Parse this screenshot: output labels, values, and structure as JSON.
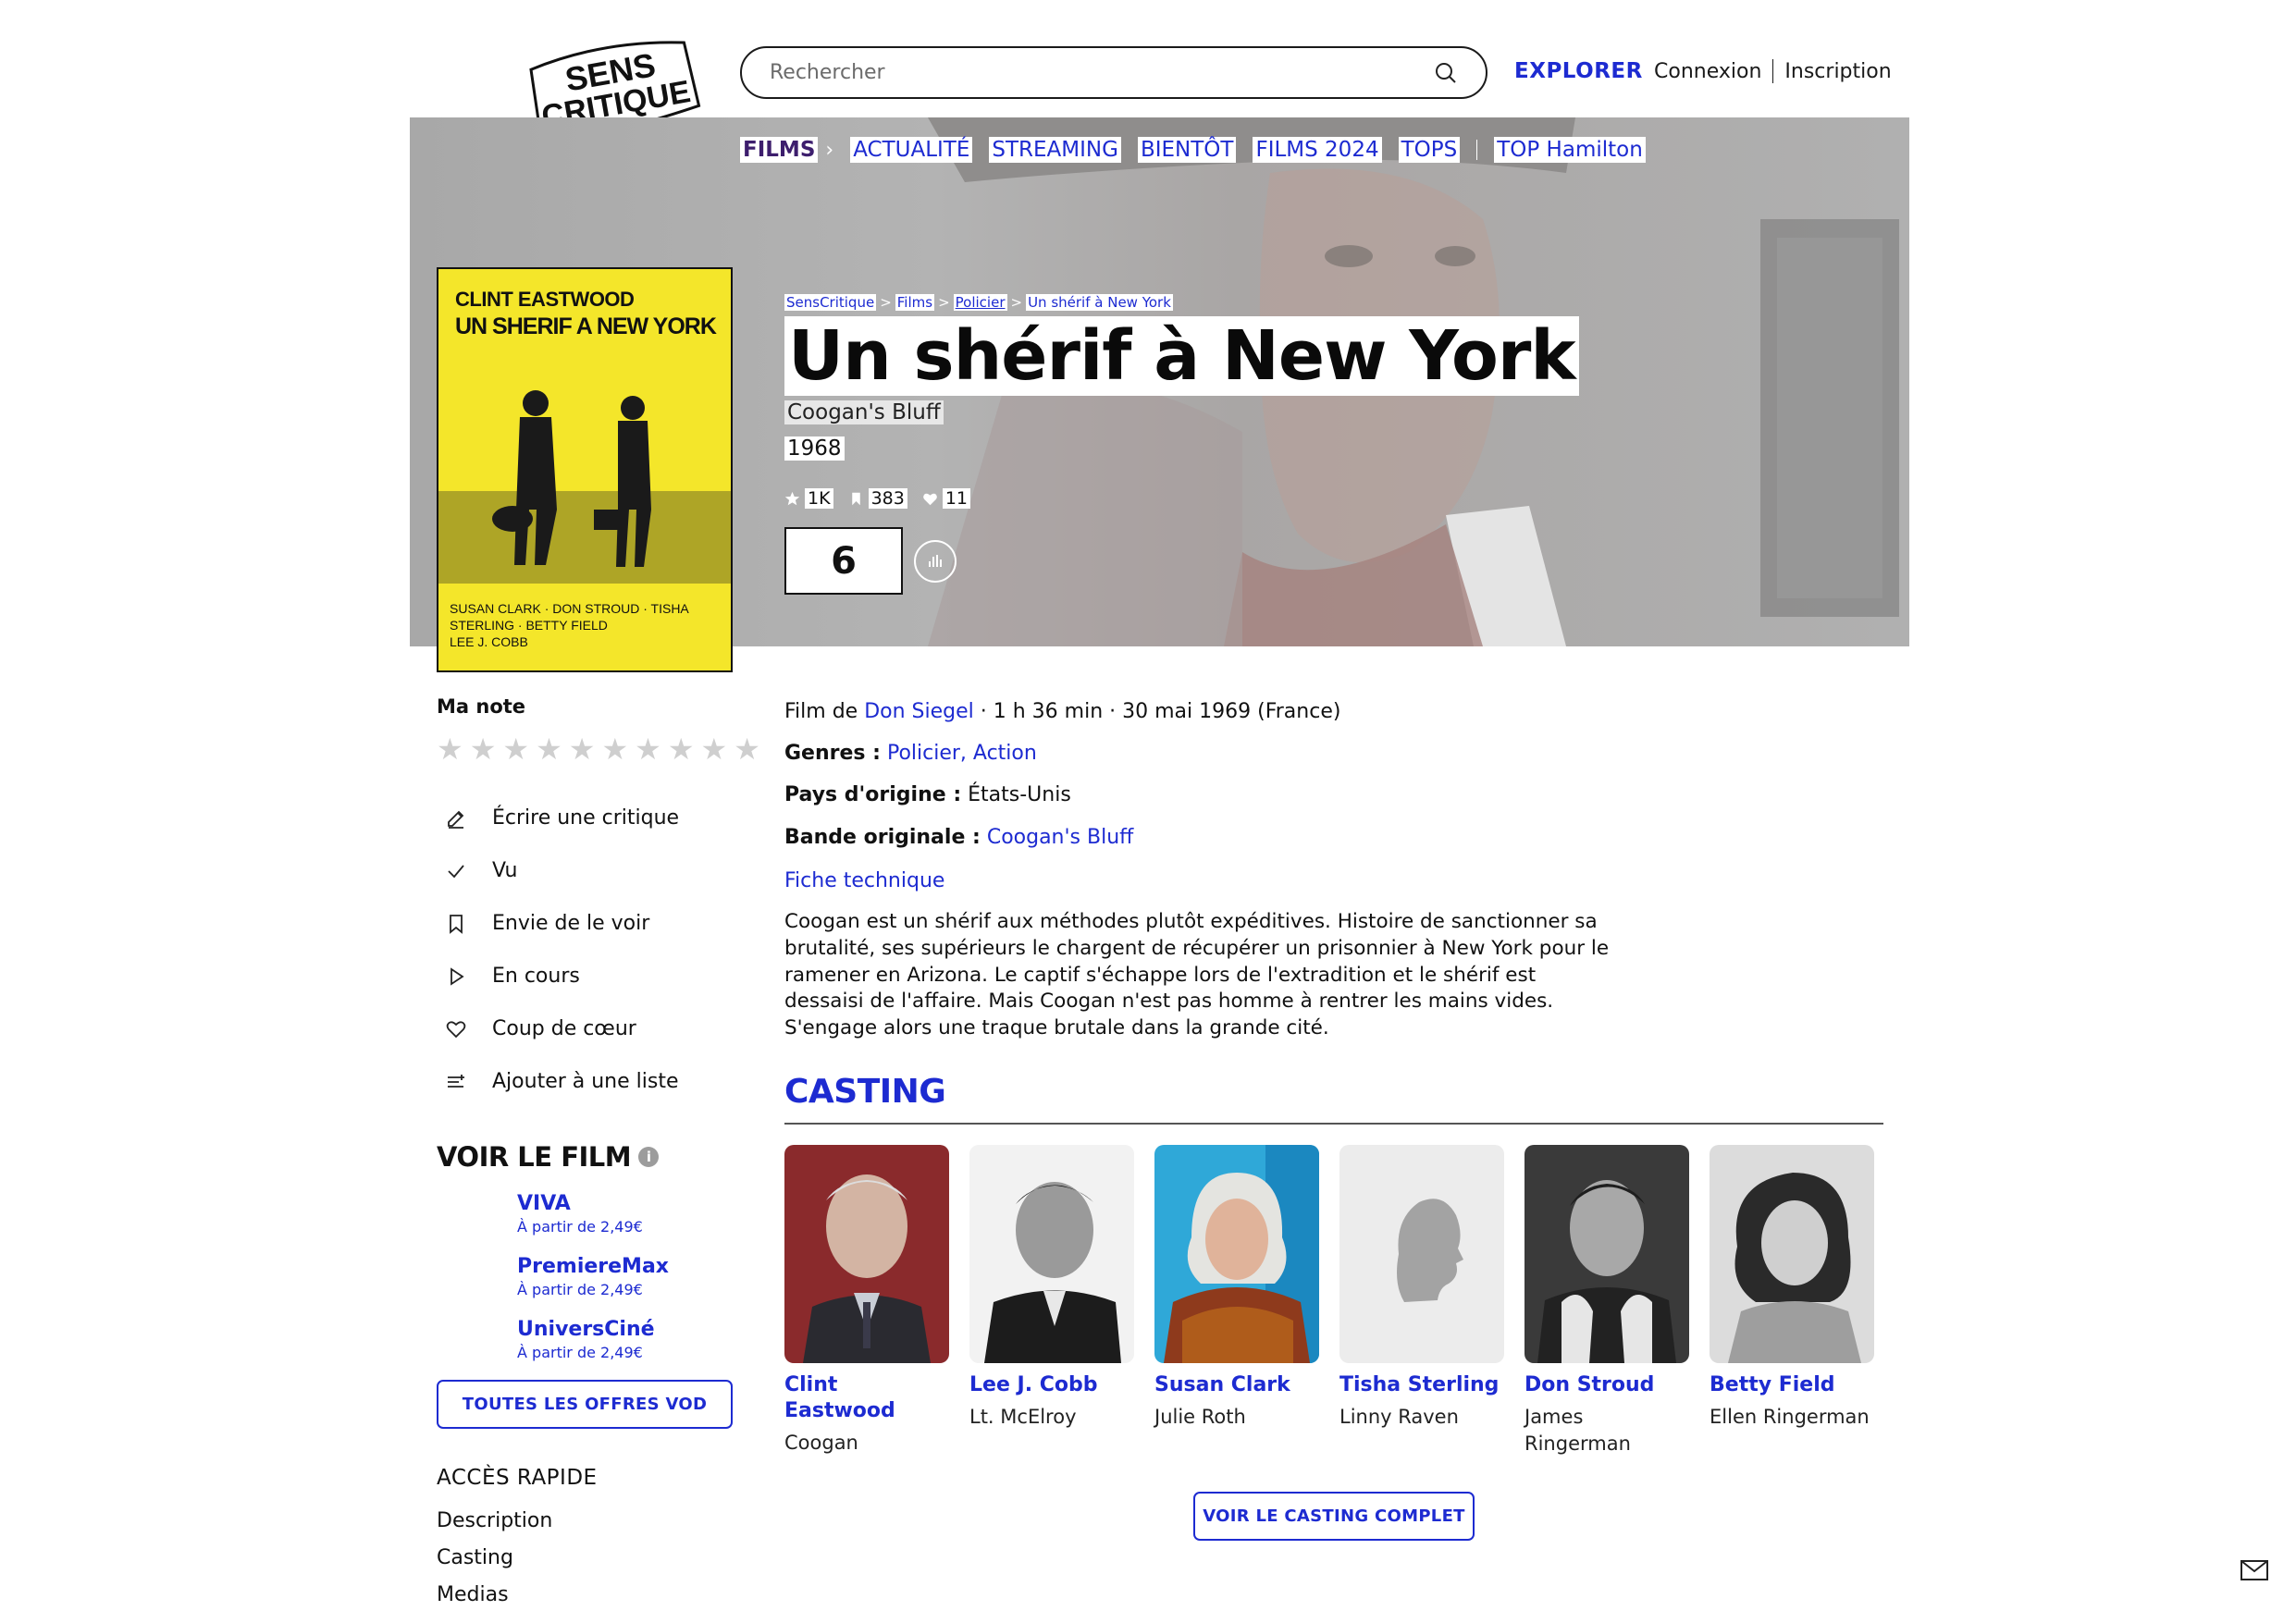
{
  "header": {
    "logo_lines": [
      "SENS",
      "CRITIQUE"
    ],
    "search_placeholder": "Rechercher",
    "explorer": "EXPLORER",
    "login": "Connexion",
    "signup": "Inscription"
  },
  "nav": {
    "items": [
      "FILMS",
      "ACTUALITÉ",
      "STREAMING",
      "BIENTÔT",
      "FILMS 2024",
      "TOPS"
    ],
    "extra": "TOP Hamilton"
  },
  "breadcrumb": [
    "SensCritique",
    "Films",
    "Policier",
    "Un shérif à New York"
  ],
  "film": {
    "title": "Un shérif à New York",
    "original_title": "Coogan's Bluff",
    "year": "1968",
    "stats": {
      "ratings": "1K",
      "wishlist": "383",
      "favorites": "11"
    },
    "score": "6",
    "poster": {
      "actor": "CLINT EASTWOOD",
      "title": "UN SHERIF A NEW YORK",
      "credits_1": "SUSAN CLARK · DON STROUD · TISHA STERLING · BETTY FIELD",
      "credits_2": "LEE J. COBB"
    }
  },
  "sidebar": {
    "my_rating": "Ma note",
    "stars_count": 10,
    "actions": [
      {
        "label": "Écrire une critique",
        "icon": "pencil-icon"
      },
      {
        "label": "Vu",
        "icon": "check-icon"
      },
      {
        "label": "Envie de le voir",
        "icon": "bookmark-icon"
      },
      {
        "label": "En cours",
        "icon": "play-icon"
      },
      {
        "label": "Coup de cœur",
        "icon": "heart-icon"
      },
      {
        "label": "Ajouter à une liste",
        "icon": "list-add-icon"
      }
    ],
    "voir_title": "VOIR LE FILM",
    "vod": [
      {
        "name": "VIVA",
        "price": "À partir de 2,49€"
      },
      {
        "name": "PremiereMax",
        "price": "À partir de 2,49€"
      },
      {
        "name": "UniversCiné",
        "price": "À partir de 2,49€"
      }
    ],
    "vod_button": "TOUTES LES OFFRES VOD",
    "quick_access_title": "ACCÈS RAPIDE",
    "quick_access": [
      "Description",
      "Casting",
      "Medias"
    ]
  },
  "details": {
    "film_de": "Film de",
    "director": "Don Siegel",
    "duration_release": " · 1 h 36 min · 30 mai 1969 (France)",
    "genres_label": "Genres :",
    "genres": "Policier, Action",
    "country_label": "Pays d'origine :",
    "country": "États-Unis",
    "soundtrack_label": "Bande originale :",
    "soundtrack": "Coogan's Bluff",
    "fiche": "Fiche technique",
    "synopsis": "Coogan est un shérif aux méthodes plutôt expéditives. Histoire de sanctionner sa brutalité, ses supérieurs le chargent de récupérer un prisonnier à New York pour le ramener en Arizona. Le captif s'échappe lors de l'extradition et le shérif est dessaisi de l'affaire. Mais Coogan n'est pas homme à rentrer les mains vides. S'engage alors une traque brutale dans la grande cité."
  },
  "casting": {
    "title": "CASTING",
    "members": [
      {
        "name": "Clint Eastwood",
        "role": "Coogan"
      },
      {
        "name": "Lee J. Cobb",
        "role": "Lt. McElroy"
      },
      {
        "name": "Susan Clark",
        "role": "Julie Roth"
      },
      {
        "name": "Tisha Sterling",
        "role": "Linny Raven"
      },
      {
        "name": "Don Stroud",
        "role": "James Ringerman"
      },
      {
        "name": "Betty Field",
        "role": "Ellen Ringerman"
      }
    ],
    "button": "VOIR LE CASTING COMPLET"
  },
  "colors": {
    "accent": "#1d2bd1",
    "nav_active": "#3d1e6d",
    "poster_yellow": "#f4e62a"
  }
}
